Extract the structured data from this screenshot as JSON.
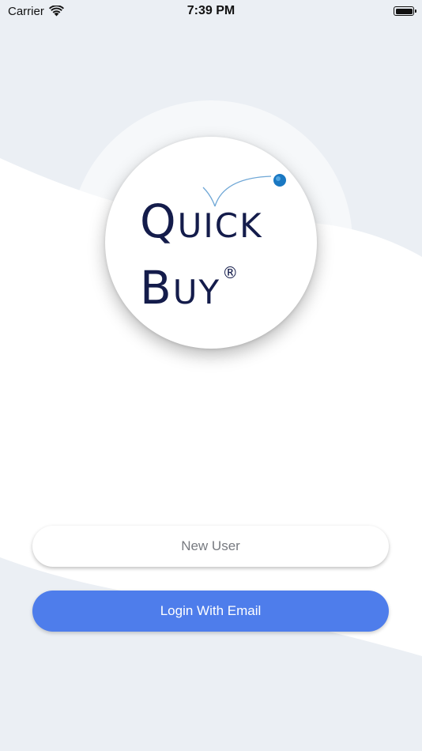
{
  "status_bar": {
    "carrier": "Carrier",
    "time": "7:39 PM",
    "wifi_icon": "wifi-icon",
    "battery_icon": "battery-icon"
  },
  "logo": {
    "line1_first": "Q",
    "line1_rest": "UICK",
    "line2_first": "B",
    "line2_rest": "UY",
    "registered": "®"
  },
  "buttons": {
    "new_user": "New User",
    "login_email": "Login With Email"
  },
  "colors": {
    "background": "#ebeff4",
    "primary": "#4e7deb",
    "logo_text": "#141c4b",
    "logo_dot": "#1a78c2"
  }
}
